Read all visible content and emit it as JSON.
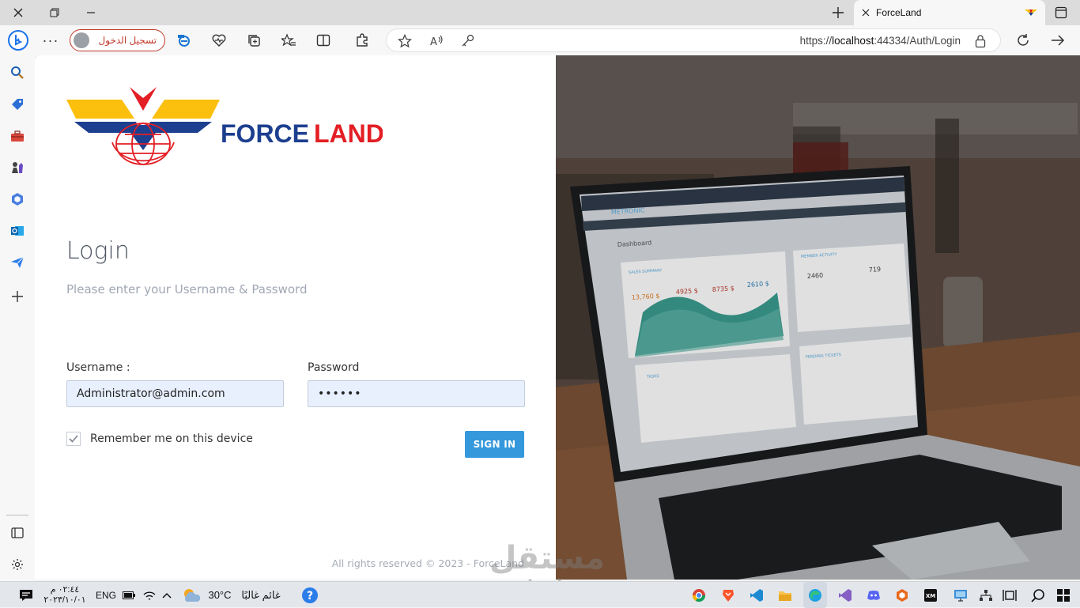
{
  "browser": {
    "tab_title": "ForceLand",
    "profile_label": "تسجيل الدخول",
    "url_prefix": "https://",
    "url_host": "localhost",
    "url_rest": ":44334/Auth/Login"
  },
  "login": {
    "brand_force": "FORCE",
    "brand_land": "LAND",
    "title": "Login",
    "subtitle": "Please enter your Username & Password",
    "username_label": "Username :",
    "username_value": "Administrator@admin.com",
    "password_label": "Password",
    "password_value": "••••••",
    "remember_label": "Remember me on this device",
    "remember_checked": true,
    "signin_label": "SIGN IN",
    "copyright": "All rights reserved © 2023 - ForceLand"
  },
  "laptop_screen": {
    "brand": "METRONIC",
    "page_title": "Dashboard",
    "widget_sales": "SALES SUMMARY",
    "widget_members": "MEMBER ACTIVITY",
    "widget_tasks": "TASKS",
    "widget_pending": "PENDING TICKETS",
    "stat_1": "13,760 $",
    "stat_2": "4925 $",
    "stat_3": "8735 $",
    "stat_4": "2610 $",
    "stat_5": "2460",
    "stat_6": "719"
  },
  "watermark": {
    "arabic": "مستقل",
    "latin": "mostaql.com"
  },
  "taskbar": {
    "time": "٠٢:٤٤ م",
    "date": "٢٠٢٣/١٠/٠١",
    "language": "ENG",
    "temperature": "30°C",
    "weather": "غائم غالبًا"
  },
  "colors": {
    "brand_blue": "#1d3f8f",
    "brand_red": "#e31e24",
    "brand_yellow": "#fbbf0e",
    "signin_button": "#3598dc",
    "profile_border": "#c0392b"
  }
}
